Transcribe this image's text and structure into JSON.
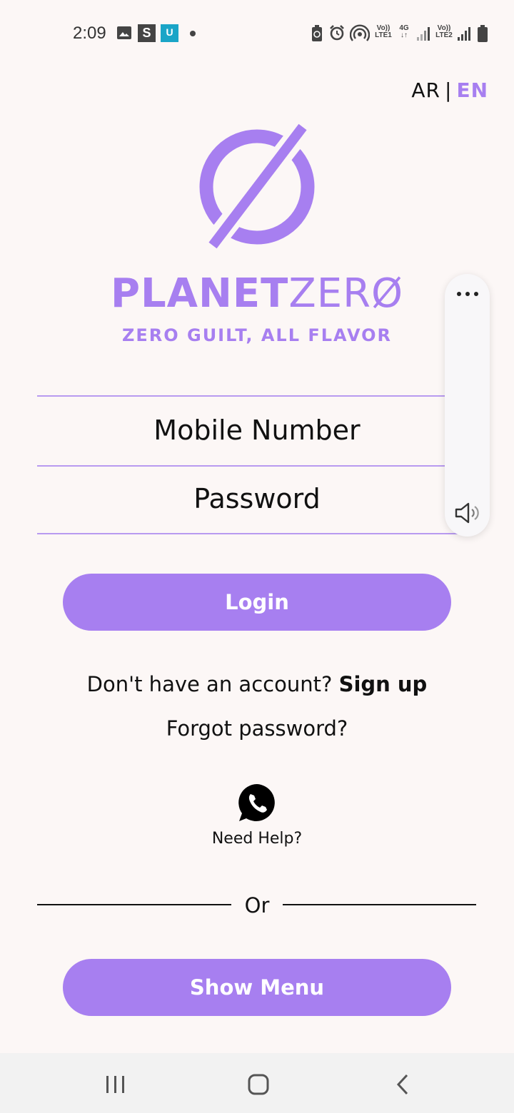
{
  "status_bar": {
    "time": "2:09",
    "notif_s": "S",
    "notif_u": "U",
    "lte1_top": "Vo))",
    "lte1_bottom": "LTE1",
    "net_top": "4G",
    "lte2_top": "Vo))",
    "lte2_bottom": "LTE2",
    "icons": [
      "image-icon",
      "s-app-icon",
      "u-app-icon",
      "dot-icon",
      "battery-saver-icon",
      "alarm-icon",
      "hotspot-icon",
      "signal-icon",
      "signal-icon",
      "battery-icon"
    ]
  },
  "language": {
    "ar": "AR",
    "separator": "|",
    "en": "EN"
  },
  "brand": {
    "name_bold": "PLANET",
    "name_light": "ZERØ",
    "tagline": "ZERO GUILT, ALL FLAVOR",
    "accent_color": "#a77ff0"
  },
  "form": {
    "mobile_placeholder": "Mobile Number",
    "password_placeholder": "Password",
    "login_label": "Login"
  },
  "links": {
    "no_account": "Don't have an account?",
    "sign_up": "Sign up",
    "forgot_password": "Forgot password?",
    "need_help": "Need Help?"
  },
  "divider": {
    "or": "Or"
  },
  "show_menu_label": "Show Menu",
  "side_panel": {
    "icons": [
      "more-icon",
      "volume-icon"
    ]
  },
  "nav_bar": {
    "icons": [
      "recents-icon",
      "home-icon",
      "back-icon"
    ]
  }
}
